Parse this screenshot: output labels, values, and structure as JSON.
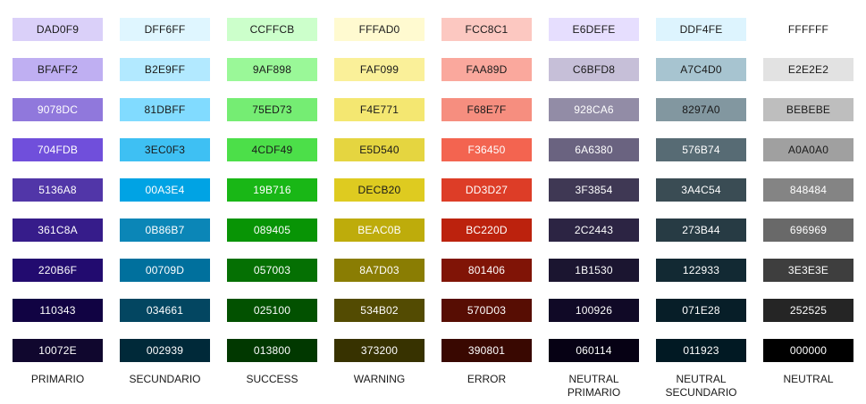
{
  "palette": {
    "columns": [
      {
        "name": "PRIMARIO",
        "swatches": [
          "DAD0F9",
          "BFAFF2",
          "9078DC",
          "704FDB",
          "5136A8",
          "361C8A",
          "220B6F",
          "110343",
          "10072E"
        ],
        "text_colors": [
          "#1a1a1a",
          "#1a1a1a",
          "#ffffff",
          "#ffffff",
          "#ffffff",
          "#ffffff",
          "#ffffff",
          "#ffffff",
          "#ffffff"
        ]
      },
      {
        "name": "SECUNDARIO",
        "swatches": [
          "DFF6FF",
          "B2E9FF",
          "81DBFF",
          "3EC0F3",
          "00A3E4",
          "0B86B7",
          "00709D",
          "034661",
          "002939"
        ],
        "text_colors": [
          "#1a1a1a",
          "#1a1a1a",
          "#1a1a1a",
          "#1a1a1a",
          "#ffffff",
          "#ffffff",
          "#ffffff",
          "#ffffff",
          "#ffffff"
        ]
      },
      {
        "name": "SUCCESS",
        "swatches": [
          "CCFFCB",
          "9AF898",
          "75ED73",
          "4CDF49",
          "19B716",
          "089405",
          "057003",
          "025100",
          "013800"
        ],
        "text_colors": [
          "#1a1a1a",
          "#1a1a1a",
          "#1a1a1a",
          "#1a1a1a",
          "#ffffff",
          "#ffffff",
          "#ffffff",
          "#ffffff",
          "#ffffff"
        ]
      },
      {
        "name": "WARNING",
        "swatches": [
          "FFFAD0",
          "FAF099",
          "F4E771",
          "E5D540",
          "DECB20",
          "BEAC0B",
          "8A7D03",
          "534B02",
          "373200"
        ],
        "text_colors": [
          "#1a1a1a",
          "#1a1a1a",
          "#1a1a1a",
          "#1a1a1a",
          "#1a1a1a",
          "#ffffff",
          "#ffffff",
          "#ffffff",
          "#ffffff"
        ]
      },
      {
        "name": "ERROR",
        "swatches": [
          "FCC8C1",
          "FAA89D",
          "F68E7F",
          "F36450",
          "DD3D27",
          "BC220D",
          "801406",
          "570D03",
          "390801"
        ],
        "text_colors": [
          "#1a1a1a",
          "#1a1a1a",
          "#1a1a1a",
          "#ffffff",
          "#ffffff",
          "#ffffff",
          "#ffffff",
          "#ffffff",
          "#ffffff"
        ]
      },
      {
        "name": "NEUTRAL\nPRIMARIO",
        "swatches": [
          "E6DEFE",
          "C6BFD8",
          "928CA6",
          "6A6380",
          "3F3854",
          "2C2443",
          "1B1530",
          "100926",
          "060114"
        ],
        "text_colors": [
          "#1a1a1a",
          "#1a1a1a",
          "#ffffff",
          "#ffffff",
          "#ffffff",
          "#ffffff",
          "#ffffff",
          "#ffffff",
          "#ffffff"
        ]
      },
      {
        "name": "NEUTRAL\nSECUNDARIO",
        "swatches": [
          "DDF4FE",
          "A7C4D0",
          "8297A0",
          "576B74",
          "3A4C54",
          "273B44",
          "122933",
          "071E28",
          "011923"
        ],
        "text_colors": [
          "#1a1a1a",
          "#1a1a1a",
          "#1a1a1a",
          "#ffffff",
          "#ffffff",
          "#ffffff",
          "#ffffff",
          "#ffffff",
          "#ffffff"
        ]
      },
      {
        "name": "NEUTRAL",
        "swatches": [
          "FFFFFF",
          "E2E2E2",
          "BEBEBE",
          "A0A0A0",
          "848484",
          "696969",
          "3E3E3E",
          "252525",
          "000000"
        ],
        "text_colors": [
          "#1a1a1a",
          "#1a1a1a",
          "#1a1a1a",
          "#1a1a1a",
          "#ffffff",
          "#ffffff",
          "#ffffff",
          "#ffffff",
          "#ffffff"
        ]
      }
    ]
  }
}
